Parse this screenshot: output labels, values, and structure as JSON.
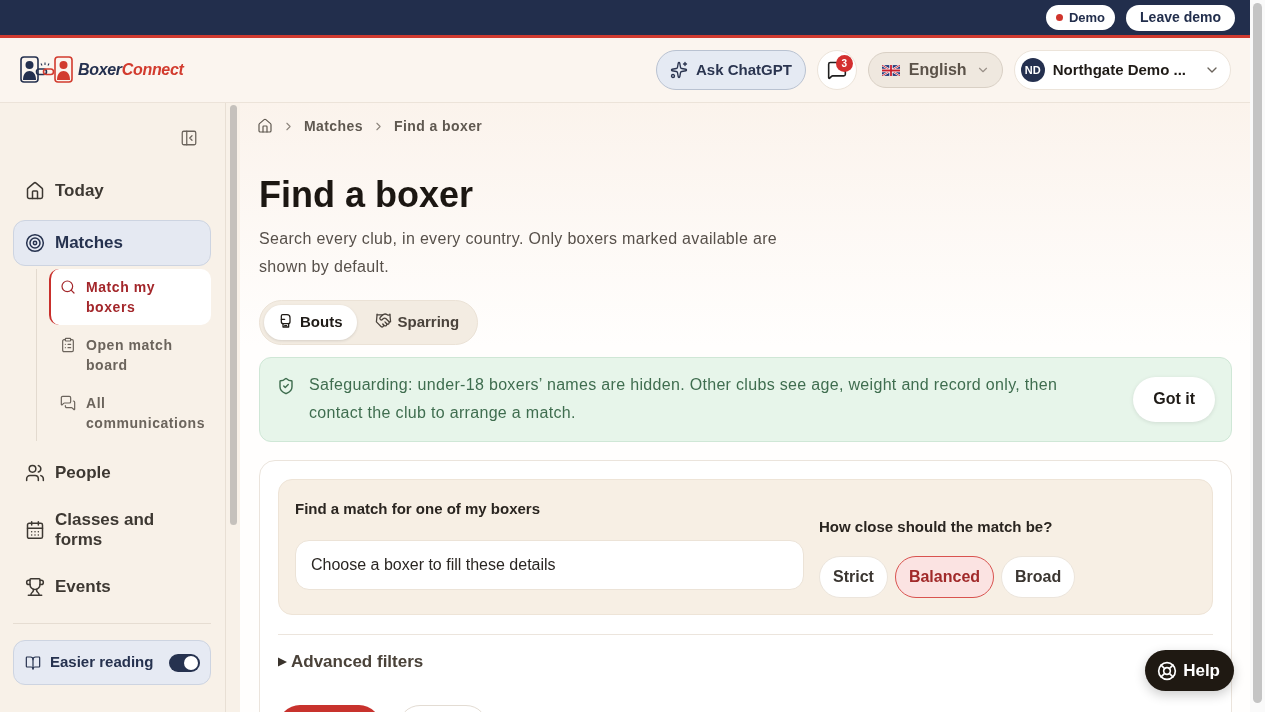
{
  "top_bar": {
    "demo_badge": "Demo",
    "leave_button": "Leave demo"
  },
  "header": {
    "logo": {
      "first": "Boxer",
      "second": "Connect"
    },
    "ask_button": "Ask ChatGPT",
    "messages_badge": "3",
    "language": "English",
    "account": {
      "initials": "ND",
      "name": "Northgate Demo ..."
    }
  },
  "sidebar": {
    "items": [
      {
        "label": "Today",
        "selected": false
      },
      {
        "label": "Matches",
        "selected": true,
        "children": [
          {
            "label": "Match my boxers",
            "selected": true
          },
          {
            "label": "Open match board",
            "selected": false
          },
          {
            "label": "All communications",
            "selected": false
          }
        ]
      },
      {
        "label": "People",
        "selected": false
      },
      {
        "label": "Classes and forms",
        "selected": false
      },
      {
        "label": "Events",
        "selected": false
      }
    ],
    "easier_reading": {
      "label": "Easier reading",
      "on": true
    }
  },
  "breadcrumb": [
    "Matches",
    "Find a boxer"
  ],
  "page": {
    "title": "Find a boxer",
    "description": "Search every club, in every country. Only boxers marked available are shown by default."
  },
  "tabs": [
    {
      "label": "Bouts",
      "selected": true
    },
    {
      "label": "Sparring",
      "selected": false
    }
  ],
  "notice": {
    "text": "Safeguarding: under-18 boxers’ names are hidden. Other clubs see age, weight and record only, then contact the club to arrange a match.",
    "button": "Got it"
  },
  "match_form": {
    "label": "Find a match for one of my boxers",
    "boxer_field": {
      "placeholder": "Choose a boxer to fill these details"
    },
    "closeness": {
      "label": "How close should the match be?",
      "options": [
        {
          "label": "Strict",
          "selected": false
        },
        {
          "label": "Balanced",
          "selected": true
        },
        {
          "label": "Broad",
          "selected": false
        }
      ]
    },
    "advanced_filters": {
      "label": "Advanced filters",
      "expanded": false
    }
  },
  "help_button": "Help"
}
